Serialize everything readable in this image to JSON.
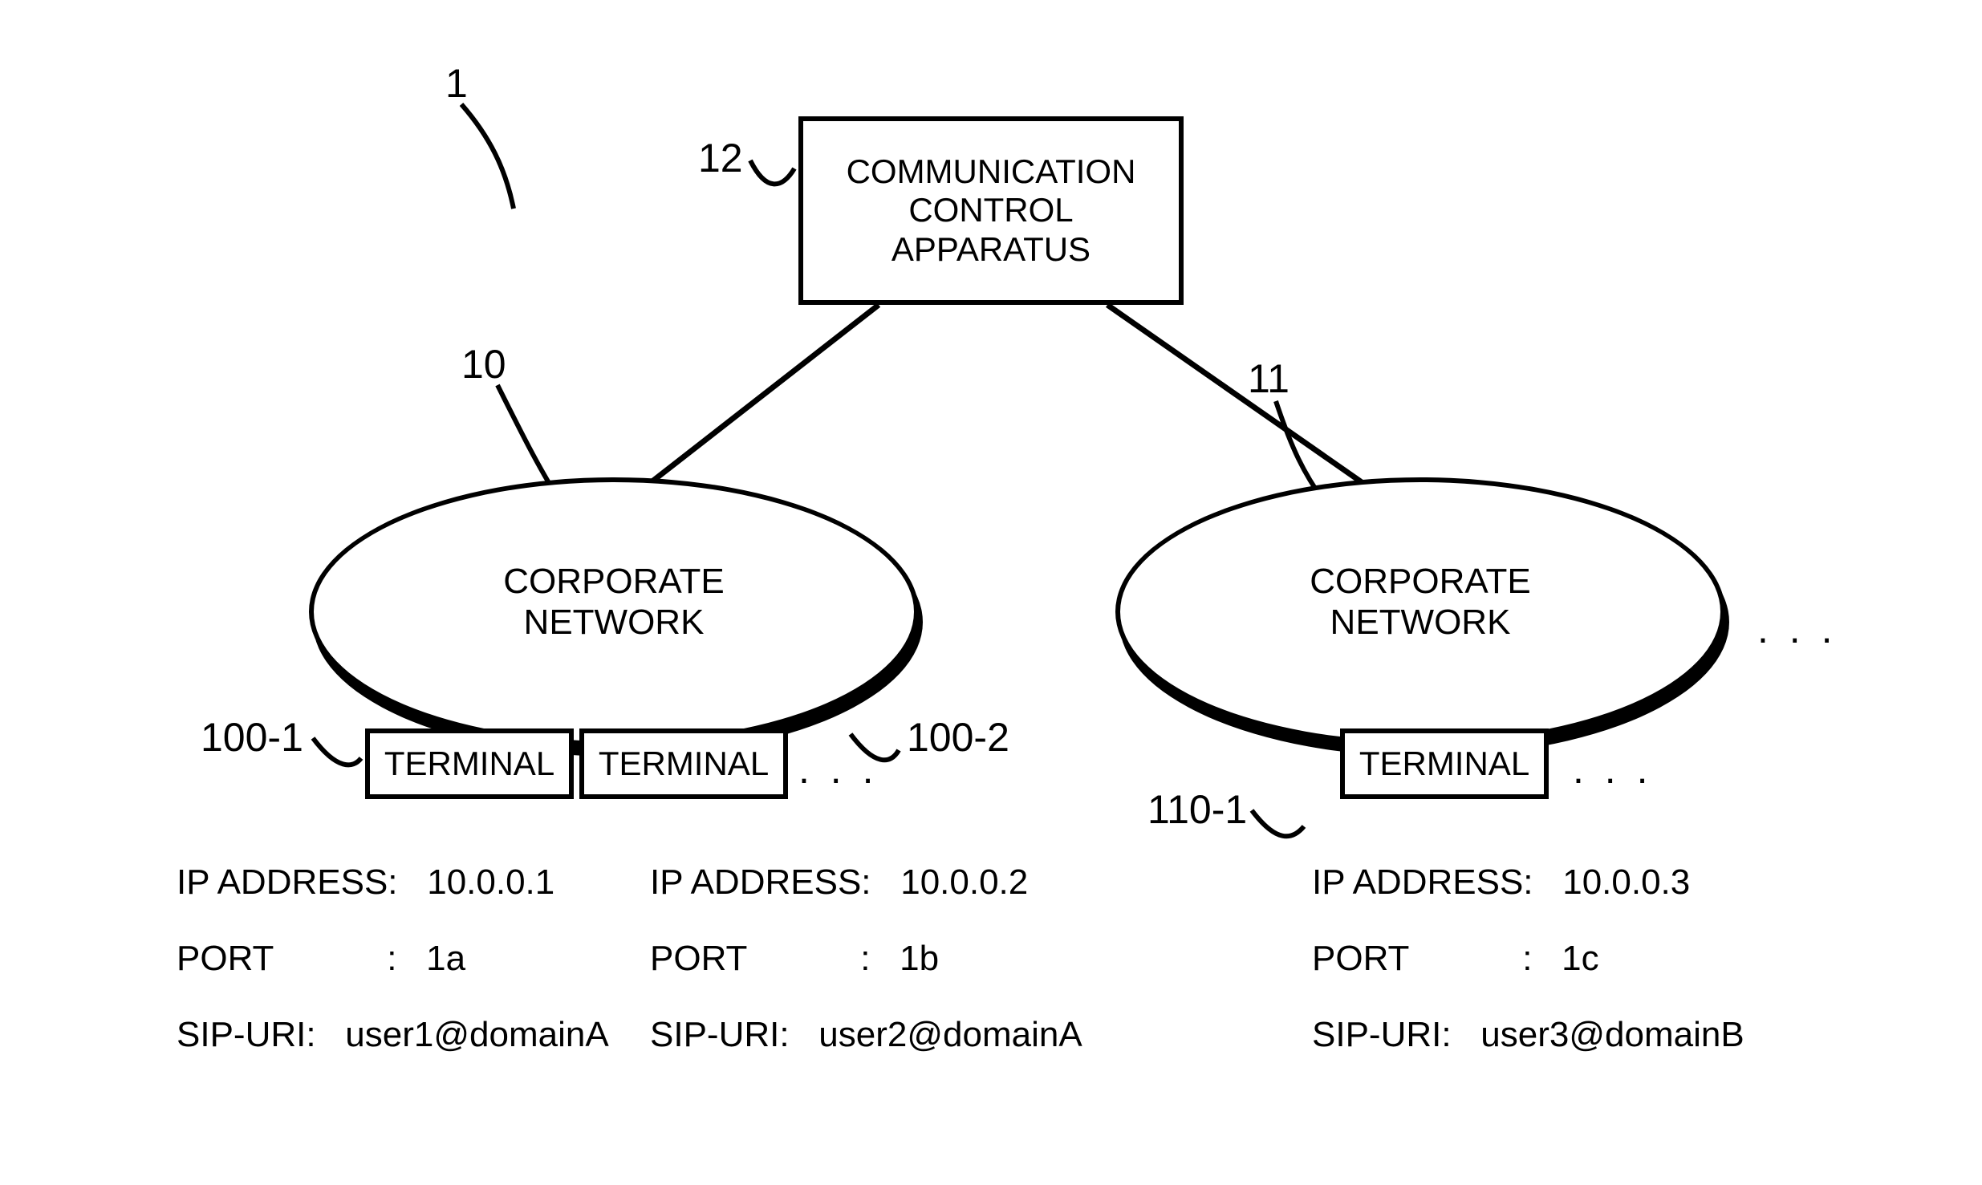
{
  "refs": {
    "system": "1",
    "net_left": "10",
    "net_right": "11",
    "controller": "12",
    "term1": "100-1",
    "term2": "100-2",
    "term3": "110-1"
  },
  "controller": {
    "label": "COMMUNICATION\nCONTROL\nAPPARATUS"
  },
  "networks": {
    "left": "CORPORATE\nNETWORK",
    "right": "CORPORATE\nNETWORK"
  },
  "terminals": {
    "t1": "TERMINAL",
    "t2": "TERMINAL",
    "t3": "TERMINAL"
  },
  "details": {
    "t1": {
      "ip_label": "IP ADDRESS:",
      "ip_value": "10.0.0.1",
      "port_label": "PORT",
      "port_colon": ":",
      "port_value": "1a",
      "sip_label": "SIP-URI:",
      "sip_value": "user1@domainA"
    },
    "t2": {
      "ip_label": "IP ADDRESS:",
      "ip_value": "10.0.0.2",
      "port_label": "PORT",
      "port_colon": ":",
      "port_value": "1b",
      "sip_label": "SIP-URI:",
      "sip_value": "user2@domainA"
    },
    "t3": {
      "ip_label": "IP ADDRESS:",
      "ip_value": "10.0.0.3",
      "port_label": "PORT",
      "port_colon": ":",
      "port_value": "1c",
      "sip_label": "SIP-URI:",
      "sip_value": "user3@domainB"
    }
  },
  "ellipsis": ". . ."
}
